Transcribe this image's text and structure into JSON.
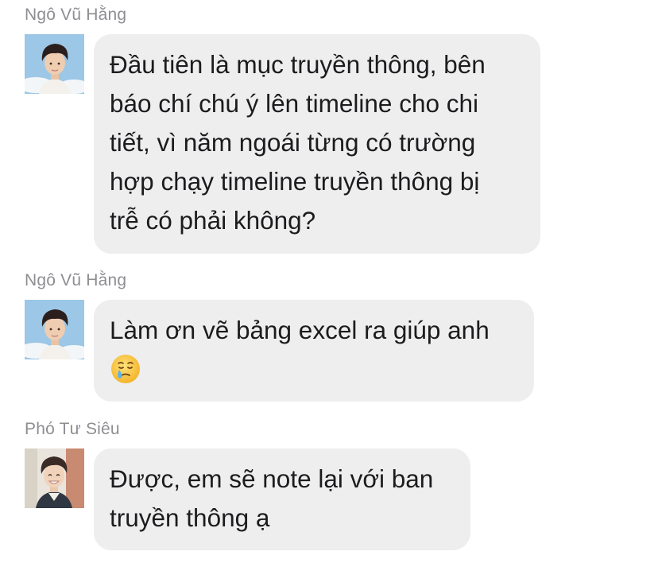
{
  "messages": [
    {
      "sender": "Ngô Vũ Hằng",
      "avatar_icon": "avatar-boy-sky-icon",
      "lines": [
        "Đầu tiên là mục truyền thông, bên",
        "báo chí chú ý lên timeline cho chi",
        "tiết, vì năm ngoái từng có trường",
        "hợp chạy timeline truyền thông bị",
        "trễ có phải không?"
      ]
    },
    {
      "sender": "Ngô Vũ Hằng",
      "avatar_icon": "avatar-boy-sky-icon",
      "lines": [
        "Làm ơn vẽ bảng excel ra giúp anh"
      ],
      "emoji": "crying-face-emoji"
    },
    {
      "sender": "Phó Tư Siêu",
      "avatar_icon": "avatar-boy-smiling-icon",
      "lines": [
        "Được, em sẽ note lại với ban",
        "truyền thông ạ"
      ]
    }
  ],
  "colors": {
    "bubble": "#eeeeef",
    "sender_text": "#8e8e93",
    "message_text": "#1c1c1e"
  }
}
